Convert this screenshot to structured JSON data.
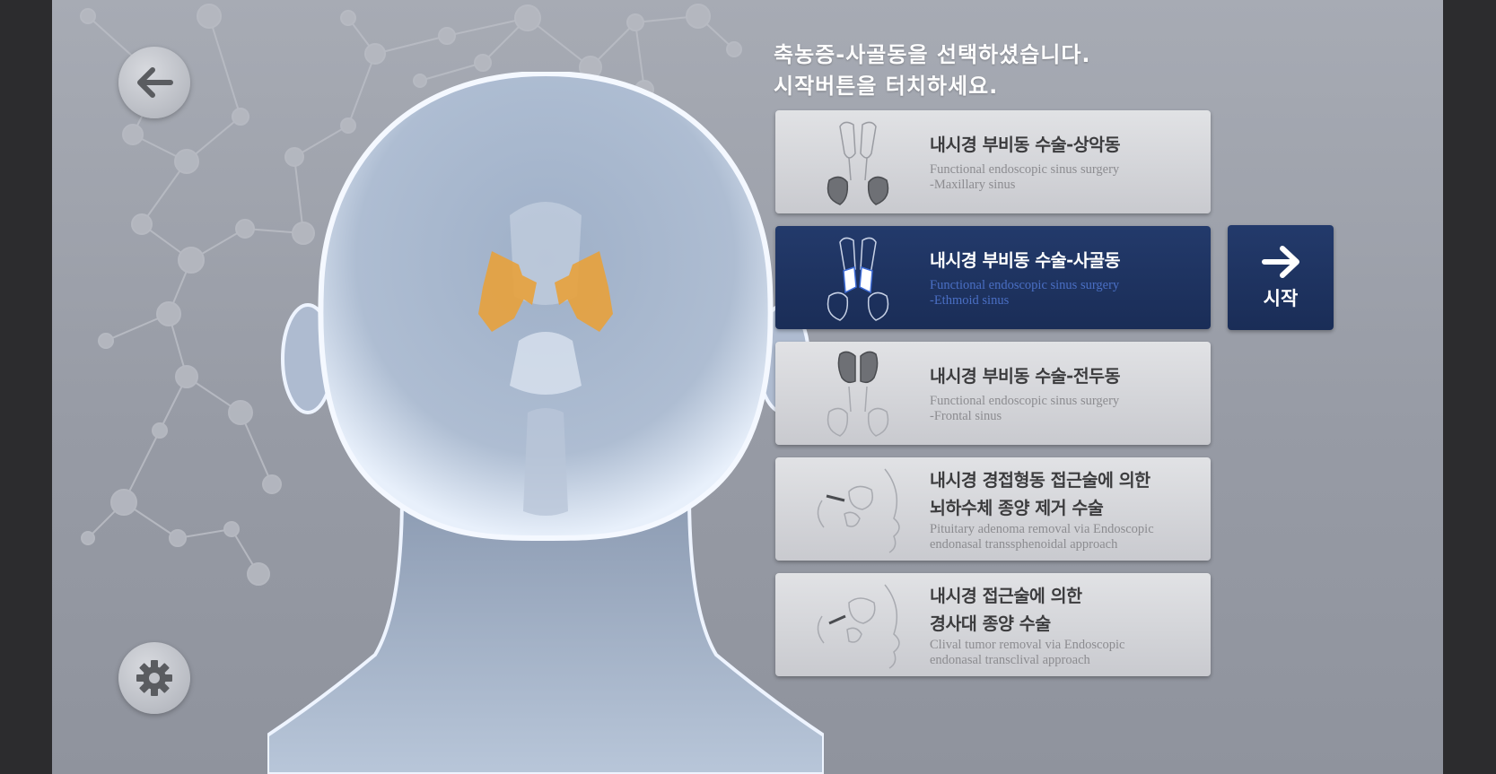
{
  "prompt": {
    "line1": "축농증-사골동을 선택하셨습니다.",
    "line2": "시작버튼을 터치하세요."
  },
  "nav": {
    "back_icon": "arrow-left-icon",
    "settings_icon": "gear-icon"
  },
  "procedures": [
    {
      "title": "내시경 부비동 수술-상악동",
      "subtitle_1": "Functional endoscopic sinus surgery",
      "subtitle_2": "-Maxillary sinus",
      "selected": false,
      "icon": "maxillary-sinus-icon"
    },
    {
      "title": "내시경 부비동 수술-사골동",
      "subtitle_1": "Functional endoscopic sinus surgery",
      "subtitle_2": "-Ethmoid sinus",
      "selected": true,
      "icon": "ethmoid-sinus-icon"
    },
    {
      "title": "내시경 부비동 수술-전두동",
      "subtitle_1": "Functional endoscopic sinus surgery",
      "subtitle_2": "-Frontal sinus",
      "selected": false,
      "icon": "frontal-sinus-icon"
    },
    {
      "title": "내시경 경접형동 접근술에 의한",
      "title_2": "뇌하수체 종양 제거 수술",
      "subtitle_1": "Pituitary adenoma removal via Endoscopic",
      "subtitle_2": "endonasal transsphenoidal approach",
      "selected": false,
      "icon": "pituitary-approach-icon"
    },
    {
      "title": "내시경 접근술에 의한",
      "title_2": "경사대 종양 수술",
      "subtitle_1": "Clival tumor removal  via Endoscopic",
      "subtitle_2": "endonasal transclival approach",
      "selected": false,
      "icon": "clival-approach-icon"
    }
  ],
  "start_button": {
    "label": "시작",
    "icon": "arrow-right-icon"
  },
  "colors": {
    "selected_card": "#1f3462",
    "highlight_sinus": "#e8a23c",
    "background": "#9a9ea8"
  }
}
